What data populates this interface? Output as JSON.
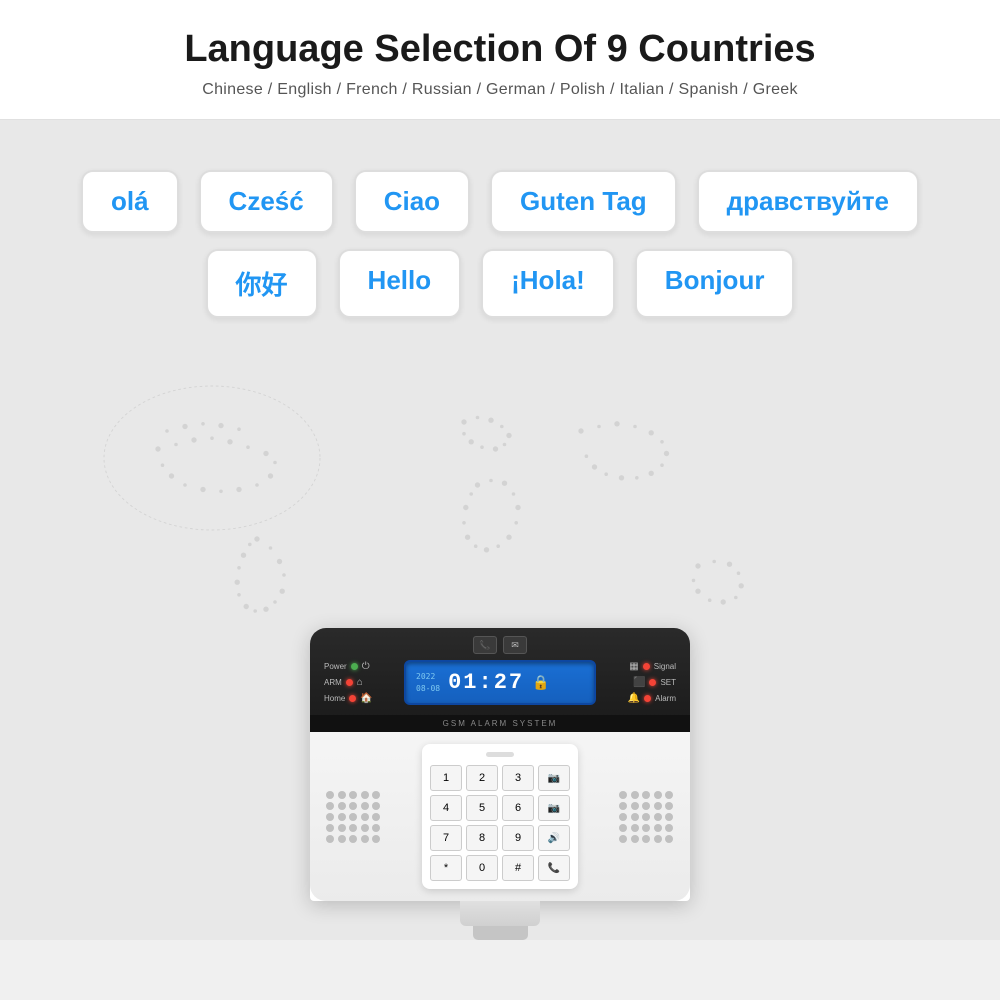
{
  "header": {
    "title": "Language Selection Of 9 Countries",
    "subtitle": "Chinese / English / French / Russian / German / Polish / Italian / Spanish / Greek"
  },
  "greetings": {
    "row1": [
      {
        "text": "olá",
        "id": "portuguese"
      },
      {
        "text": "Cześć",
        "id": "polish-greeting"
      },
      {
        "text": "Ciao",
        "id": "italian-greeting"
      },
      {
        "text": "Guten Tag",
        "id": "german-greeting"
      },
      {
        "text": "дравствуйте",
        "id": "russian-greeting"
      }
    ],
    "row2": [
      {
        "text": "你好",
        "id": "chinese-greeting"
      },
      {
        "text": "Hello",
        "id": "english-greeting"
      },
      {
        "text": "¡Hola!",
        "id": "spanish-greeting"
      },
      {
        "text": "Bonjour",
        "id": "french-greeting"
      }
    ]
  },
  "device": {
    "gsm_label": "GSM ALARM SYSTEM",
    "time": "01:27",
    "date_line1": "2022",
    "date_line2": "08-08",
    "status_left": [
      {
        "label": "Power",
        "icon": "⏻"
      },
      {
        "label": "ARM",
        "icon": "🏠"
      },
      {
        "label": "Home",
        "icon": "🏡"
      }
    ],
    "status_right": [
      {
        "label": "Signal",
        "icon": "📶"
      },
      {
        "label": "SET",
        "icon": "⬛"
      },
      {
        "label": "Alarm",
        "icon": "🔔"
      }
    ],
    "keypad": [
      "1",
      "2",
      "3",
      "📷",
      "4",
      "5",
      "6",
      "📷",
      "7",
      "8",
      "9",
      "🔊",
      "*",
      "0",
      "#",
      "📞"
    ]
  },
  "colors": {
    "accent_blue": "#2196F3",
    "dark_panel": "#1e1e1e",
    "led_green": "#4CAF50",
    "led_red": "#f44336",
    "lcd_blue": "#1a6fd4"
  }
}
